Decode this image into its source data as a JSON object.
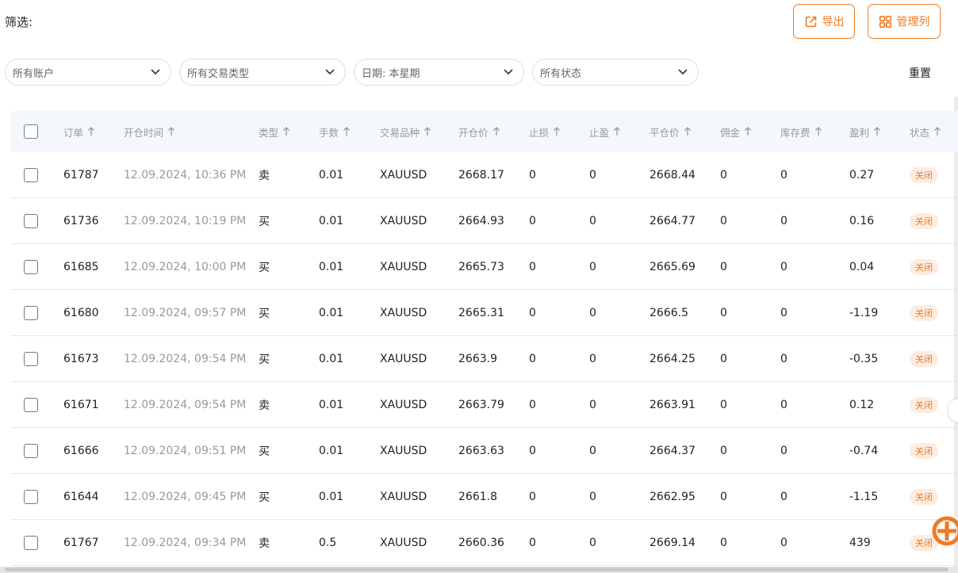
{
  "filter": {
    "label": "筛选:",
    "dropdowns": [
      {
        "value": "所有账户"
      },
      {
        "value": "所有交易类型"
      },
      {
        "value": "日期: 本星期"
      },
      {
        "value": "所有状态"
      }
    ],
    "reset_label": "重置"
  },
  "toolbar": {
    "export_label": "导出",
    "manage_columns_label": "管理列"
  },
  "colors": {
    "accent": "#f07a22",
    "badge_bg": "#fdecdf",
    "header_bg": "#f4f7fb"
  },
  "table": {
    "columns": [
      "订单",
      "开仓时间",
      "类型",
      "手数",
      "交易品种",
      "开仓价",
      "止损",
      "止盈",
      "平仓价",
      "佣金",
      "库存费",
      "盈利",
      "状态"
    ],
    "rows": [
      {
        "order": "61787",
        "time": "12.09.2024, 10:36 PM",
        "type": "卖",
        "lots": "0.01",
        "symbol": "XAUUSD",
        "open": "2668.17",
        "sl": "0",
        "tp": "0",
        "close": "2668.44",
        "commission": "0",
        "swap": "0",
        "profit": "0.27",
        "status": "关闭"
      },
      {
        "order": "61736",
        "time": "12.09.2024, 10:19 PM",
        "type": "买",
        "lots": "0.01",
        "symbol": "XAUUSD",
        "open": "2664.93",
        "sl": "0",
        "tp": "0",
        "close": "2664.77",
        "commission": "0",
        "swap": "0",
        "profit": "0.16",
        "status": "关闭"
      },
      {
        "order": "61685",
        "time": "12.09.2024, 10:00 PM",
        "type": "买",
        "lots": "0.01",
        "symbol": "XAUUSD",
        "open": "2665.73",
        "sl": "0",
        "tp": "0",
        "close": "2665.69",
        "commission": "0",
        "swap": "0",
        "profit": "0.04",
        "status": "关闭"
      },
      {
        "order": "61680",
        "time": "12.09.2024, 09:57 PM",
        "type": "买",
        "lots": "0.01",
        "symbol": "XAUUSD",
        "open": "2665.31",
        "sl": "0",
        "tp": "0",
        "close": "2666.5",
        "commission": "0",
        "swap": "0",
        "profit": "-1.19",
        "status": "关闭"
      },
      {
        "order": "61673",
        "time": "12.09.2024, 09:54 PM",
        "type": "买",
        "lots": "0.01",
        "symbol": "XAUUSD",
        "open": "2663.9",
        "sl": "0",
        "tp": "0",
        "close": "2664.25",
        "commission": "0",
        "swap": "0",
        "profit": "-0.35",
        "status": "关闭"
      },
      {
        "order": "61671",
        "time": "12.09.2024, 09:54 PM",
        "type": "卖",
        "lots": "0.01",
        "symbol": "XAUUSD",
        "open": "2663.79",
        "sl": "0",
        "tp": "0",
        "close": "2663.91",
        "commission": "0",
        "swap": "0",
        "profit": "0.12",
        "status": "关闭"
      },
      {
        "order": "61666",
        "time": "12.09.2024, 09:51 PM",
        "type": "买",
        "lots": "0.01",
        "symbol": "XAUUSD",
        "open": "2663.63",
        "sl": "0",
        "tp": "0",
        "close": "2664.37",
        "commission": "0",
        "swap": "0",
        "profit": "-0.74",
        "status": "关闭"
      },
      {
        "order": "61644",
        "time": "12.09.2024, 09:45 PM",
        "type": "买",
        "lots": "0.01",
        "symbol": "XAUUSD",
        "open": "2661.8",
        "sl": "0",
        "tp": "0",
        "close": "2662.95",
        "commission": "0",
        "swap": "0",
        "profit": "-1.15",
        "status": "关闭"
      },
      {
        "order": "61767",
        "time": "12.09.2024, 09:34 PM",
        "type": "卖",
        "lots": "0.5",
        "symbol": "XAUUSD",
        "open": "2660.36",
        "sl": "0",
        "tp": "0",
        "close": "2669.14",
        "commission": "0",
        "swap": "0",
        "profit": "439",
        "status": "关闭"
      }
    ]
  }
}
